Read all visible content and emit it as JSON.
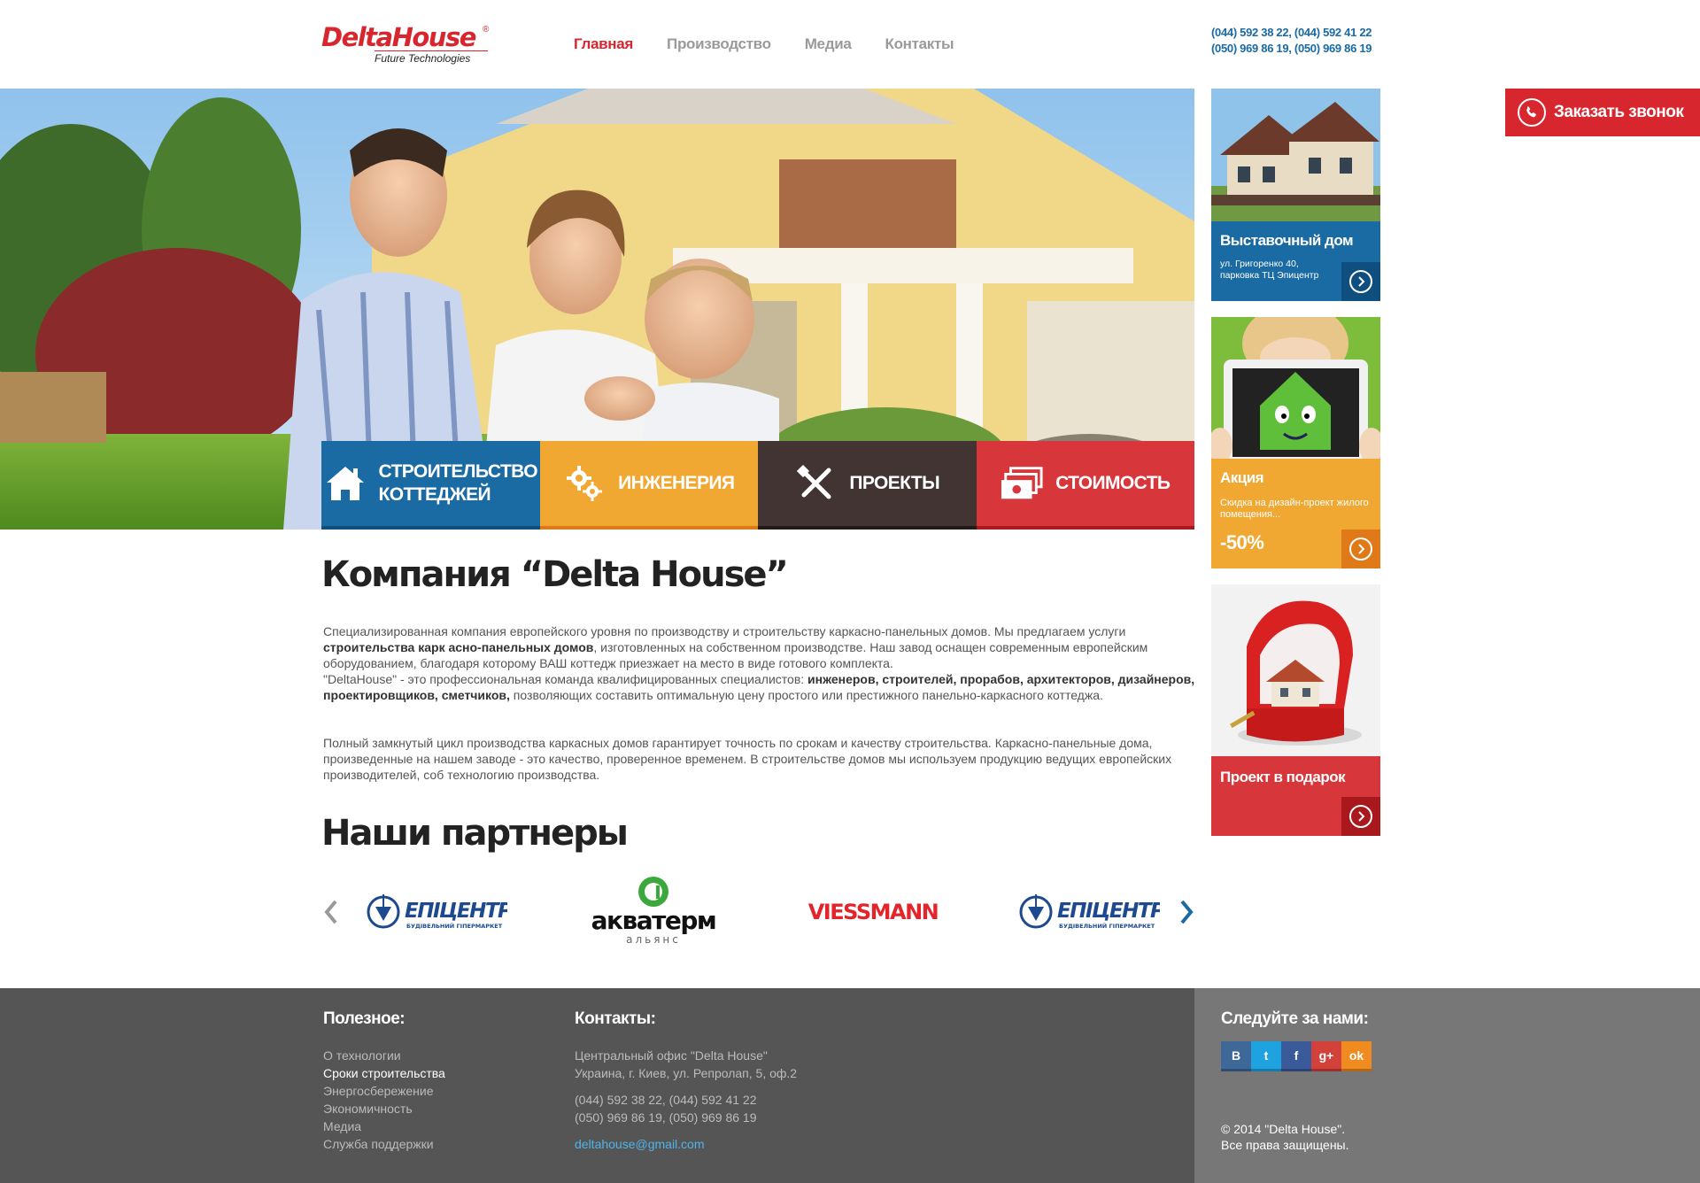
{
  "brand": {
    "name": "DeltaHouse",
    "reg": "®",
    "tagline": "Future Technologies"
  },
  "nav": [
    {
      "label": "Главная",
      "active": true
    },
    {
      "label": "Производство",
      "active": false
    },
    {
      "label": "Медиа",
      "active": false
    },
    {
      "label": "Контакты",
      "active": false
    }
  ],
  "header": {
    "phones_line1": "(044) 592 38 22, (044) 592 41 22",
    "phones_line2": "(050) 969 86 19, (050) 969 86 19"
  },
  "callback": {
    "label": "Заказать звонок",
    "icon": "phone-icon"
  },
  "tiles": [
    {
      "line1": "Строительство",
      "line2": "коттеджей",
      "icon": "house-icon",
      "color": "#1a6aa4"
    },
    {
      "line1": "Инженерия",
      "line2": "",
      "icon": "gears-icon",
      "color": "#f0a833"
    },
    {
      "line1": "Проекты",
      "line2": "",
      "icon": "tools-icon",
      "color": "#413433"
    },
    {
      "line1": "Стоимость",
      "line2": "",
      "icon": "money-icon",
      "color": "#d7363b"
    }
  ],
  "main": {
    "title": "Компания “Delta House”",
    "p1_a": "Специализированная компания европейского уровня по производству и строительству каркасно-панельных домов. Мы предлагаем услуги ",
    "p1_b": "строительства карк асно-панельных домов",
    "p1_c": ", изготовленных на собственном производстве. Наш завод оснащен современным европейским оборудованием, благодаря которому ВАШ коттедж приезжает на место в виде готового комплекта.",
    "p1_d": "\"DeltaHouse\" - это профессиональная команда квалифицированных специалистов: ",
    "p1_e": "инженеров, строителей, прорабов, архитекторов, дизайнеров, проектировщиков, сметчиков,",
    "p1_f": "  позволяющих составить оптимальную цену простого или престижного панельно-каркасного коттеджа.",
    "p2": "Полный замкнутый цикл производства каркасных домов гарантирует точность по срокам и качеству строительства. Каркасно-панельные дома, произведенные на нашем заводе - это качество, проверенное временем. В строительстве домов мы используем продукцию ведущих европейских производителей, соб   технологию производства.",
    "partners_title": "Наши партнеры"
  },
  "partners": [
    {
      "name": "ЕПІЦЕНТР",
      "sub": "БУДІВЕЛЬНИЙ ГІПЕРМАРКЕТ"
    },
    {
      "name": "акватерм",
      "sub": "альянс"
    },
    {
      "name": "VIESSMANN",
      "sub": ""
    },
    {
      "name": "ЕПІЦЕНТР",
      "sub": "БУДІВЕЛЬНИЙ ГІПЕРМАРКЕТ"
    }
  ],
  "sidebar": {
    "card1": {
      "title": "Выставочный дом",
      "sub": "ул. Григоренко 40,\nпарковка ТЦ Эпицентр"
    },
    "card2": {
      "title": "Акция",
      "sub": "Скидка на дизайн-проект жилого помещения...",
      "discount": "-50%"
    },
    "card3": {
      "title": "Проект в подарок"
    }
  },
  "footer": {
    "useful_title": "Полезное:",
    "useful": [
      "О технологии",
      "Сроки строительства",
      "Энергосбережение",
      "Экономичность",
      "Медиа",
      "Служба поддержки"
    ],
    "contacts_title": "Контакты:",
    "office": "Центральный офис \"Delta House\"",
    "address": "Украина, г. Киев, ул. Репролап, 5, оф.2",
    "phones1": "(044) 592 38 22, (044) 592 41 22",
    "phones2": "(050) 969 86 19, (050) 969 86 19",
    "email": "deltahouse@gmail.com",
    "follow_title": "Следуйте за нами:",
    "social": [
      {
        "label": "B",
        "color": "#3d6898"
      },
      {
        "label": "t",
        "color": "#1fa3e0"
      },
      {
        "label": "f",
        "color": "#3b5a9a"
      },
      {
        "label": "g+",
        "color": "#d3413b"
      },
      {
        "label": "ok",
        "color": "#ef8b1f"
      }
    ],
    "copy1": "© 2014 \"Delta House\".",
    "copy2": "Все права защищены."
  }
}
